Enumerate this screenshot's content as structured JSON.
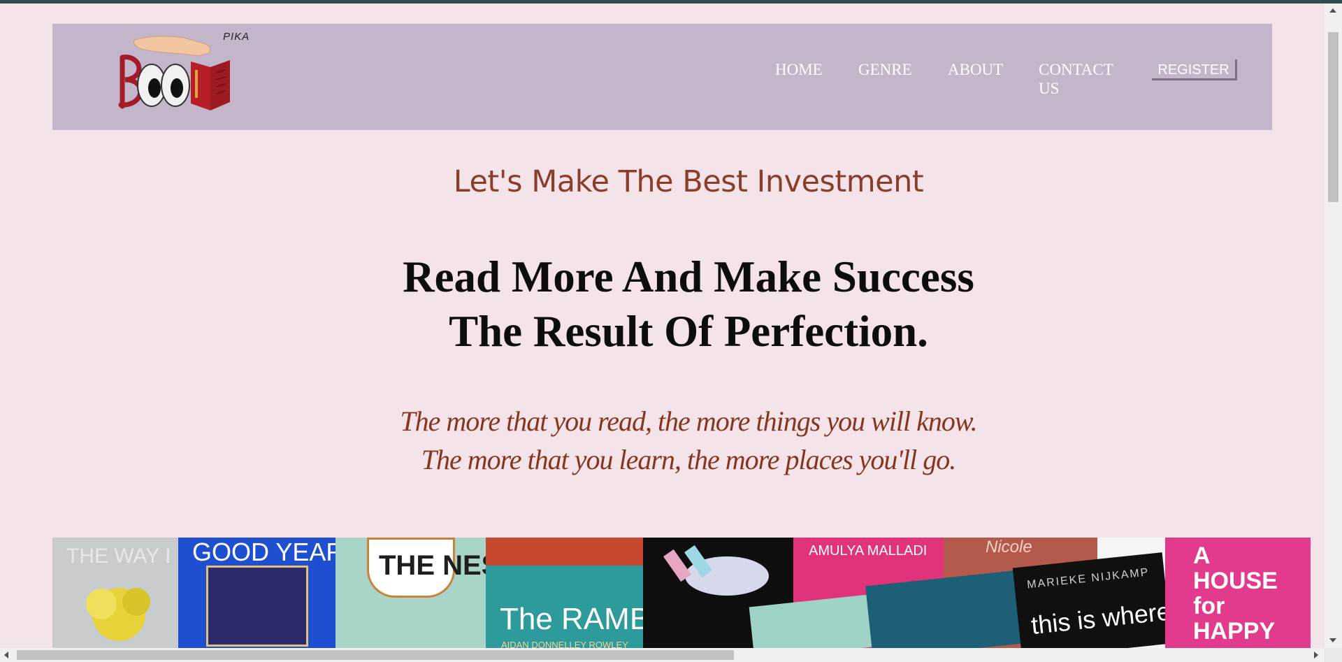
{
  "logo": {
    "small_text": "PIKA",
    "alt": "Pika Book logo"
  },
  "nav": {
    "home": "HOME",
    "genre": "GENRE",
    "about": "ABOUT",
    "contact": "CONTACT US",
    "register": "REGISTER"
  },
  "hero": {
    "tagline": "Let's Make The Best Investment",
    "headline_line1": "Read More And Make Success",
    "headline_line2": "The Result Of Perfection.",
    "quote_line1": "The more that you read, the more things you will know.",
    "quote_line2": "The more that you learn, the more places you'll go."
  },
  "banner": {
    "covers": [
      "THE WAY I USED",
      "GOOD YEAR",
      "THE NEST",
      "The RAMBLERS",
      "AIDAN DONNELLEY ROWLEY",
      "AMULYA MALLADI",
      "Nicole",
      "MARIEKE NIJKAMP",
      "this is where",
      "A HOUSE for HAPPY"
    ]
  },
  "colors": {
    "background": "#f4e4ea",
    "header": "#c3b6cb",
    "tagline": "#8a3e2a",
    "quote": "#86361f"
  }
}
